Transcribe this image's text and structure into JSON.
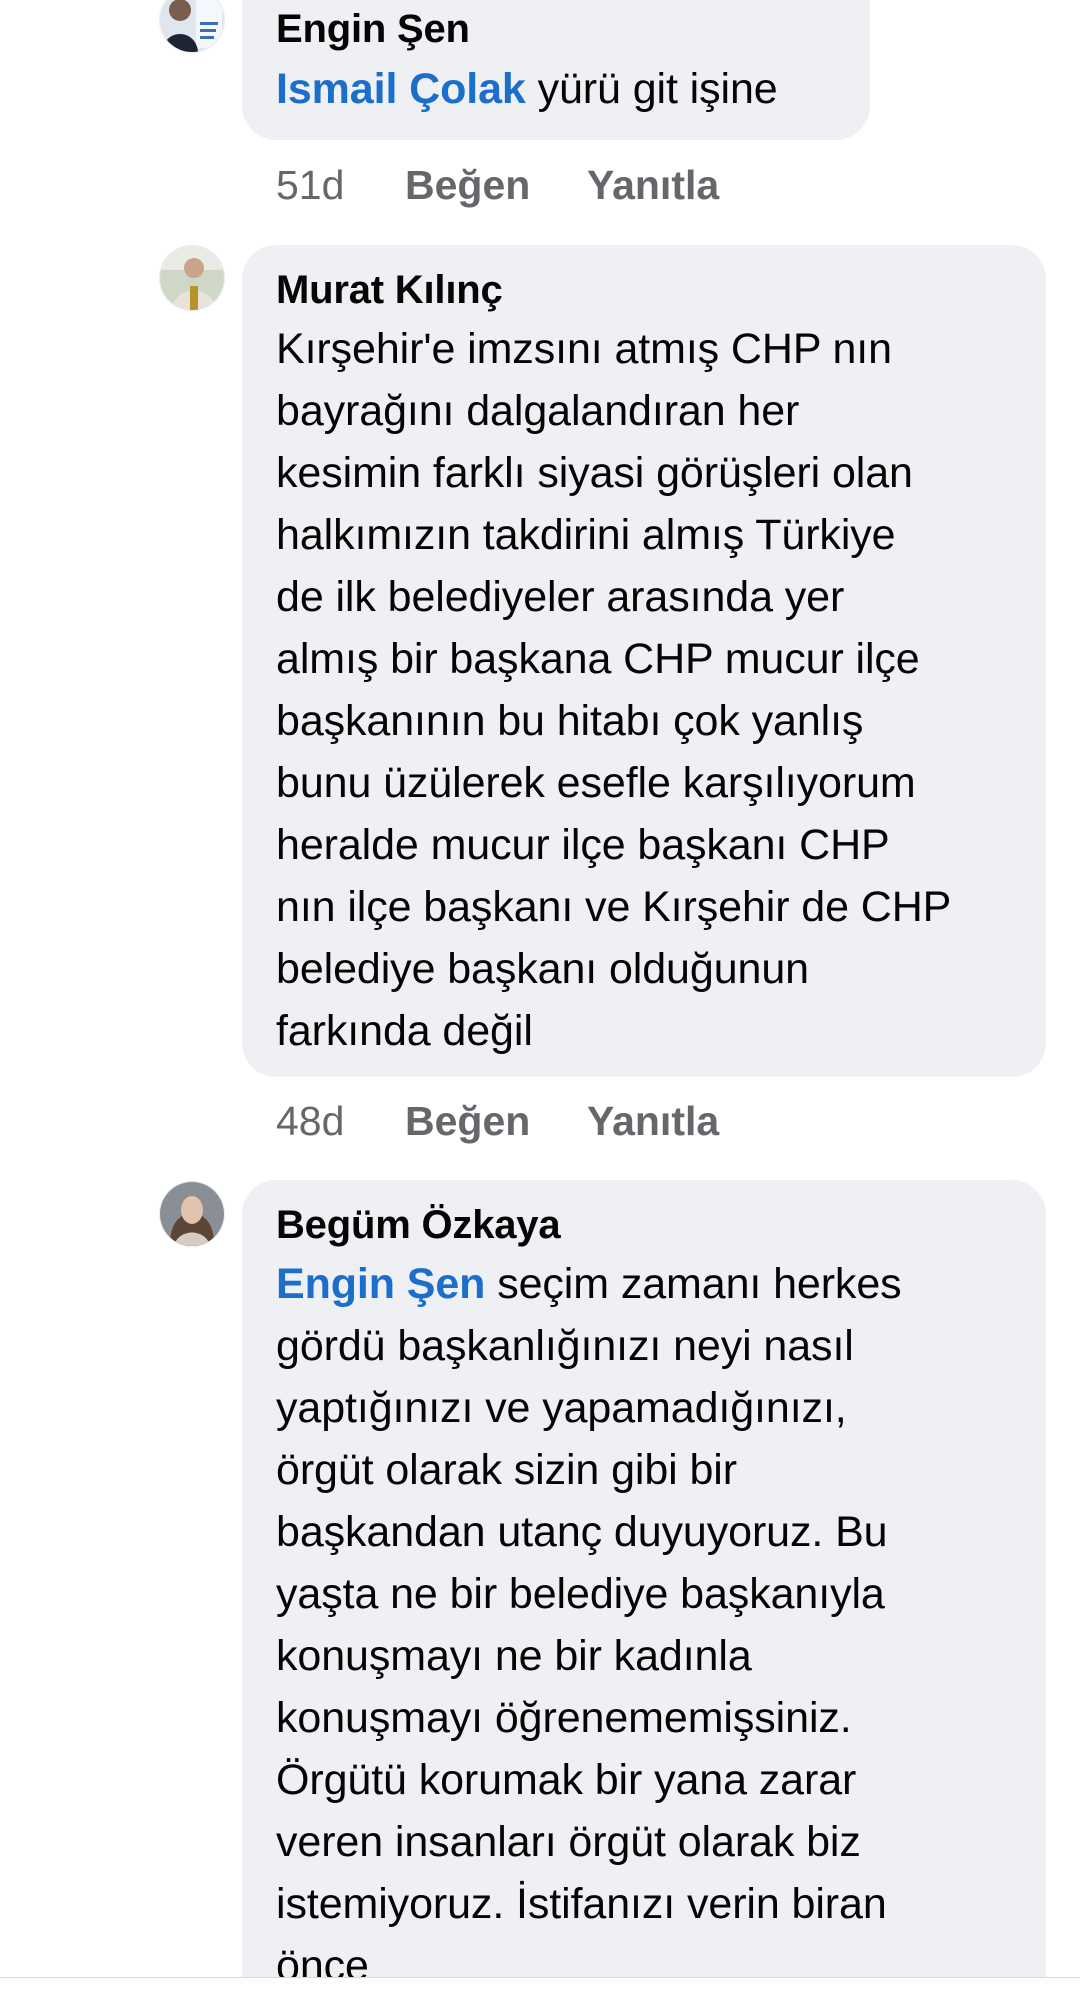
{
  "comments": [
    {
      "author": "Engin Şen",
      "mention": "Ismail Çolak",
      "text": " yürü git işine",
      "time": "51d",
      "like_label": "Beğen",
      "reply_label": "Yanıtla"
    },
    {
      "author": "Murat Kılınç",
      "text": "Kırşehir'e imzsını atmış  CHP nın\nbayrağını dalgalandıran her\nkesimin farklı siyasi görüşleri olan\nhalkımızın takdirini almış  Türkiye\nde ilk belediyeler arasında yer\nalmış  bir başkana CHP mucur ilçe\nbaşkanının bu hitabı çok yanlış\nbunu üzülerek esefle karşılıyorum\nheralde mucur ilçe başkanı CHP\nnın ilçe başkanı ve Kırşehir de CHP\nbelediye başkanı olduğunun\nfarkında değil",
      "time": "48d",
      "like_label": "Beğen",
      "reply_label": "Yanıtla"
    },
    {
      "author": "Begüm Özkaya",
      "mention": "Engin Şen",
      "text": " seçim zamanı herkes\ngördü başkanlığınızı neyi nasıl\nyaptığınızı ve yapamadığınızı,\nörgüt olarak sizin gibi bir\nbaşkandan utanç duyuyoruz. Bu\nyaşta ne bir belediye başkanıyla\nkonuşmayı ne bir kadınla\nkonuşmayı öğrenememişsiniz.\nÖrgütü korumak bir yana zarar\nveren insanları örgüt olarak biz\nistemiyoruz. İstifanızı verin biran\nönce"
    }
  ],
  "colors": {
    "bubble": "#eff0f4",
    "mention": "#1b6ec9",
    "meta": "#65676b",
    "text": "#050505"
  }
}
